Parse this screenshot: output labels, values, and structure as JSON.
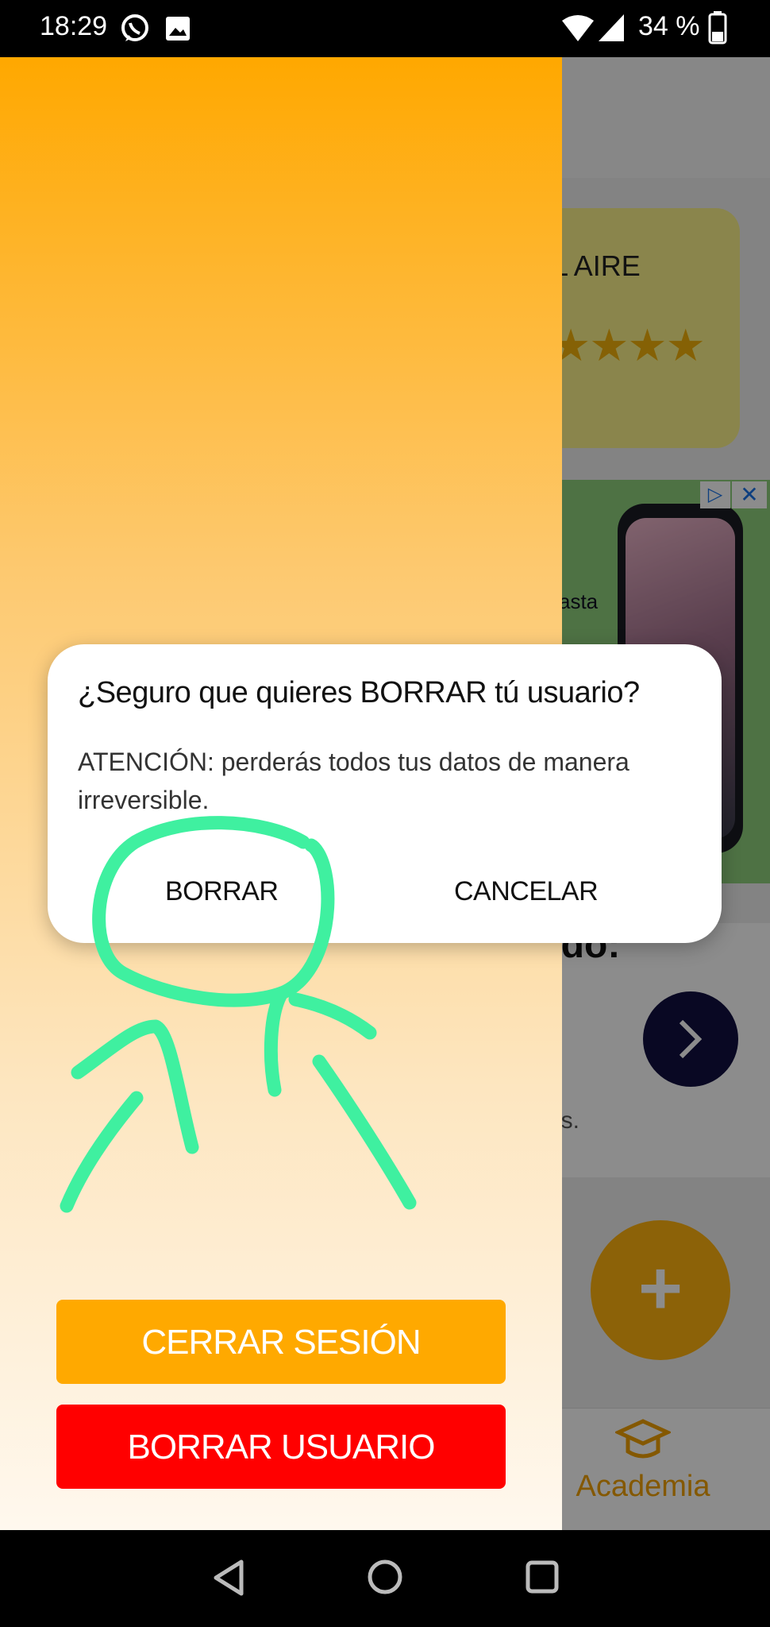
{
  "status_bar": {
    "time": "18:29",
    "battery": "34 %",
    "icons": [
      "whatsapp-icon",
      "image-icon",
      "wifi-icon",
      "signal-icon",
      "battery-icon"
    ]
  },
  "background": {
    "rating_card_text": "L AIRE",
    "rating_stars": "★★★★",
    "ad_text": "asta",
    "info_title": "ado:",
    "info_sub": "os.",
    "fab_label": "+",
    "nav_academia_label": "Academia"
  },
  "drawer": {
    "logout_label": "CERRAR SESIÓN",
    "delete_label": "BORRAR USUARIO"
  },
  "dialog": {
    "title": "¿Seguro que quieres BORRAR tú usuario?",
    "message": "ATENCIÓN: perderás todos tus datos de manera irreversible.",
    "confirm_label": "BORRAR",
    "cancel_label": "CANCELAR"
  },
  "colors": {
    "drawer_top": "#ffa800",
    "logout_button": "#ffa900",
    "delete_button": "#ff0000",
    "annotation": "#3ff0a0",
    "academia": "#f0a000"
  }
}
